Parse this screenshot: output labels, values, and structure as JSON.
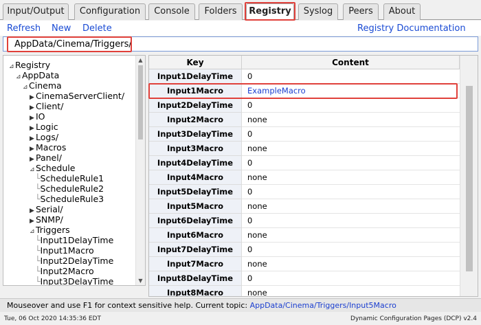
{
  "tabs": [
    {
      "label": "Input/Output"
    },
    {
      "label": "Configuration"
    },
    {
      "label": "Console"
    },
    {
      "label": "Folders"
    },
    {
      "label": "Registry",
      "active": true
    },
    {
      "label": "Syslog"
    },
    {
      "label": "Peers"
    },
    {
      "label": "About"
    }
  ],
  "actions": {
    "refresh": "Refresh",
    "new": "New",
    "delete": "Delete",
    "docs": "Registry Documentation"
  },
  "path": "AppData/Cinema/Triggers/",
  "tree": [
    {
      "label": "Registry",
      "arrow": "⊿"
    },
    {
      "label": "AppData",
      "arrow": "⊿"
    },
    {
      "label": "Cinema",
      "arrow": "⊿"
    },
    {
      "label": "CinemaServerClient/",
      "arrow": "▶"
    },
    {
      "label": "Client/",
      "arrow": "▶"
    },
    {
      "label": "IO",
      "arrow": "▶"
    },
    {
      "label": "Logic",
      "arrow": "▶"
    },
    {
      "label": "Logs/",
      "arrow": "▶"
    },
    {
      "label": "Macros",
      "arrow": "▶"
    },
    {
      "label": "Panel/",
      "arrow": "▶"
    },
    {
      "label": "Schedule",
      "arrow": "⊿"
    },
    {
      "label": "ScheduleRule1",
      "arrow": ""
    },
    {
      "label": "ScheduleRule2",
      "arrow": ""
    },
    {
      "label": "ScheduleRule3",
      "arrow": ""
    },
    {
      "label": "Serial/",
      "arrow": "▶"
    },
    {
      "label": "SNMP/",
      "arrow": "▶"
    },
    {
      "label": "Triggers",
      "arrow": "⊿"
    },
    {
      "label": "Input1DelayTime",
      "arrow": ""
    },
    {
      "label": "Input1Macro",
      "arrow": ""
    },
    {
      "label": "Input2DelayTime",
      "arrow": ""
    },
    {
      "label": "Input2Macro",
      "arrow": ""
    },
    {
      "label": "Input3DelayTime",
      "arrow": ""
    }
  ],
  "table": {
    "headers": [
      "Key",
      "Content"
    ],
    "rows": [
      {
        "key": "Input1DelayTime",
        "value": "0"
      },
      {
        "key": "Input1Macro",
        "value": "ExampleMacro",
        "link": true
      },
      {
        "key": "Input2DelayTime",
        "value": "0"
      },
      {
        "key": "Input2Macro",
        "value": "none"
      },
      {
        "key": "Input3DelayTime",
        "value": "0"
      },
      {
        "key": "Input3Macro",
        "value": "none"
      },
      {
        "key": "Input4DelayTime",
        "value": "0"
      },
      {
        "key": "Input4Macro",
        "value": "none"
      },
      {
        "key": "Input5DelayTime",
        "value": "0"
      },
      {
        "key": "Input5Macro",
        "value": "none"
      },
      {
        "key": "Input6DelayTime",
        "value": "0"
      },
      {
        "key": "Input6Macro",
        "value": "none"
      },
      {
        "key": "Input7DelayTime",
        "value": "0"
      },
      {
        "key": "Input7Macro",
        "value": "none"
      },
      {
        "key": "Input8DelayTime",
        "value": "0"
      },
      {
        "key": "Input8Macro",
        "value": "none"
      }
    ]
  },
  "help": {
    "text": "Mouseover and use F1 for context sensitive help. Current topic: ",
    "topic": "AppData/Cinema/Triggers/Input5Macro"
  },
  "status": {
    "datetime": "Tue, 06 Oct 2020 14:35:36 EDT",
    "version": "Dynamic Configuration Pages (DCP) v2.4"
  },
  "colors": {
    "highlight": "#e0403a",
    "link": "#1a4bd4"
  }
}
